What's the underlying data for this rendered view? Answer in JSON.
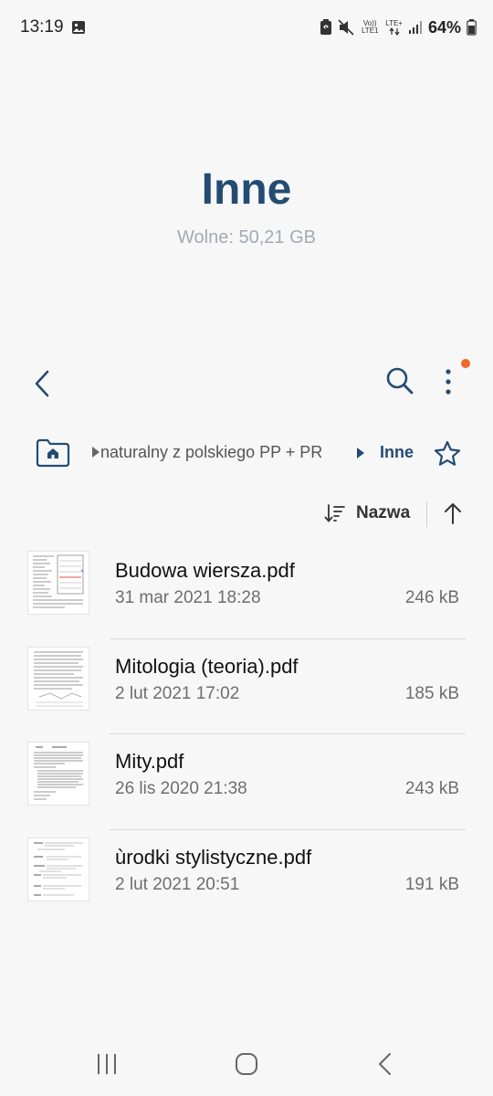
{
  "status_bar": {
    "time": "13:19",
    "battery_percent": "64%",
    "net_volte": "Vo)) LTE1",
    "net_lte": "LTE+",
    "icons": [
      "image-icon",
      "battery-saver-icon",
      "mute-icon",
      "signal-icon",
      "battery-icon"
    ]
  },
  "header": {
    "title": "Inne",
    "free_space": "Wolne: 50,21 GB"
  },
  "breadcrumb": {
    "parent": "naturalny z polskiego PP + PR",
    "current": "Inne"
  },
  "sort": {
    "label": "Nazwa"
  },
  "files": [
    {
      "name": "Budowa wiersza.pdf",
      "date": "31 mar 2021 18:28",
      "size": "246 kB"
    },
    {
      "name": "Mitologia (teoria).pdf",
      "date": "2 lut 2021 17:02",
      "size": "185 kB"
    },
    {
      "name": "Mity.pdf",
      "date": "26 lis 2020 21:38",
      "size": "243 kB"
    },
    {
      "name": "ùrodki stylistyczne.pdf",
      "date": "2 lut 2021 20:51",
      "size": "191 kB"
    }
  ],
  "colors": {
    "title": "#244c73",
    "accent_dot": "#f0672a",
    "background": "#f7f7f7"
  }
}
